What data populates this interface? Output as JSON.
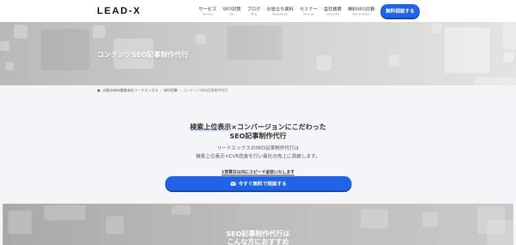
{
  "header": {
    "logo": "LEAD-X",
    "nav": [
      {
        "label": "サービス",
        "sub": "Service"
      },
      {
        "label": "SEO対策",
        "sub": "Seo"
      },
      {
        "label": "ブログ",
        "sub": "Blog"
      },
      {
        "label": "お役立ち資料",
        "sub": "Downloads"
      },
      {
        "label": "セミナー",
        "sub": "Seminar"
      },
      {
        "label": "会社概要",
        "sub": "corporate"
      },
      {
        "label": "無料SEO診断",
        "sub": "Seo analytics"
      }
    ],
    "cta": "無料相談する",
    "cta_color": "#1e63e8"
  },
  "hero": {
    "title": "コンテンツSEO記事制作代行"
  },
  "breadcrumb": {
    "items": [
      "大阪のWeb集客会社リードエックス",
      "SEO対策",
      "コンテンツSEO記事制作代行"
    ]
  },
  "intro": {
    "title_highlight": "検索上位表示",
    "title_rest": "×コンバージョンにこだわった",
    "title_line2": "SEO記事制作代行",
    "desc_line1": "リードエックスのSEO記事制作代行は",
    "desc_line2": "検索上位表示×CVR改善を行い貴社の売上に貢献します。",
    "notice": "1営業日以内にスピード返信いたします",
    "cta": "今すぐ無料で相談する"
  },
  "recommend": {
    "line1": "SEO記事制作代行は",
    "line2": "こんな方におすすめ"
  }
}
